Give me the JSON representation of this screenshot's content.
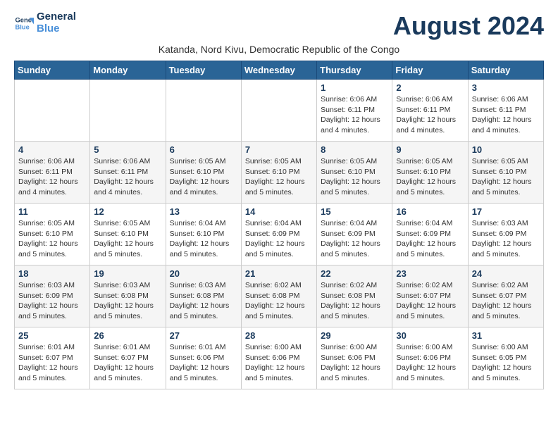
{
  "logo": {
    "line1": "General",
    "line2": "Blue"
  },
  "month_title": "August 2024",
  "subtitle": "Katanda, Nord Kivu, Democratic Republic of the Congo",
  "days_of_week": [
    "Sunday",
    "Monday",
    "Tuesday",
    "Wednesday",
    "Thursday",
    "Friday",
    "Saturday"
  ],
  "weeks": [
    [
      {
        "day": "",
        "info": ""
      },
      {
        "day": "",
        "info": ""
      },
      {
        "day": "",
        "info": ""
      },
      {
        "day": "",
        "info": ""
      },
      {
        "day": "1",
        "info": "Sunrise: 6:06 AM\nSunset: 6:11 PM\nDaylight: 12 hours and 4 minutes."
      },
      {
        "day": "2",
        "info": "Sunrise: 6:06 AM\nSunset: 6:11 PM\nDaylight: 12 hours and 4 minutes."
      },
      {
        "day": "3",
        "info": "Sunrise: 6:06 AM\nSunset: 6:11 PM\nDaylight: 12 hours and 4 minutes."
      }
    ],
    [
      {
        "day": "4",
        "info": "Sunrise: 6:06 AM\nSunset: 6:11 PM\nDaylight: 12 hours and 4 minutes."
      },
      {
        "day": "5",
        "info": "Sunrise: 6:06 AM\nSunset: 6:11 PM\nDaylight: 12 hours and 4 minutes."
      },
      {
        "day": "6",
        "info": "Sunrise: 6:05 AM\nSunset: 6:10 PM\nDaylight: 12 hours and 4 minutes."
      },
      {
        "day": "7",
        "info": "Sunrise: 6:05 AM\nSunset: 6:10 PM\nDaylight: 12 hours and 5 minutes."
      },
      {
        "day": "8",
        "info": "Sunrise: 6:05 AM\nSunset: 6:10 PM\nDaylight: 12 hours and 5 minutes."
      },
      {
        "day": "9",
        "info": "Sunrise: 6:05 AM\nSunset: 6:10 PM\nDaylight: 12 hours and 5 minutes."
      },
      {
        "day": "10",
        "info": "Sunrise: 6:05 AM\nSunset: 6:10 PM\nDaylight: 12 hours and 5 minutes."
      }
    ],
    [
      {
        "day": "11",
        "info": "Sunrise: 6:05 AM\nSunset: 6:10 PM\nDaylight: 12 hours and 5 minutes."
      },
      {
        "day": "12",
        "info": "Sunrise: 6:05 AM\nSunset: 6:10 PM\nDaylight: 12 hours and 5 minutes."
      },
      {
        "day": "13",
        "info": "Sunrise: 6:04 AM\nSunset: 6:10 PM\nDaylight: 12 hours and 5 minutes."
      },
      {
        "day": "14",
        "info": "Sunrise: 6:04 AM\nSunset: 6:09 PM\nDaylight: 12 hours and 5 minutes."
      },
      {
        "day": "15",
        "info": "Sunrise: 6:04 AM\nSunset: 6:09 PM\nDaylight: 12 hours and 5 minutes."
      },
      {
        "day": "16",
        "info": "Sunrise: 6:04 AM\nSunset: 6:09 PM\nDaylight: 12 hours and 5 minutes."
      },
      {
        "day": "17",
        "info": "Sunrise: 6:03 AM\nSunset: 6:09 PM\nDaylight: 12 hours and 5 minutes."
      }
    ],
    [
      {
        "day": "18",
        "info": "Sunrise: 6:03 AM\nSunset: 6:09 PM\nDaylight: 12 hours and 5 minutes."
      },
      {
        "day": "19",
        "info": "Sunrise: 6:03 AM\nSunset: 6:08 PM\nDaylight: 12 hours and 5 minutes."
      },
      {
        "day": "20",
        "info": "Sunrise: 6:03 AM\nSunset: 6:08 PM\nDaylight: 12 hours and 5 minutes."
      },
      {
        "day": "21",
        "info": "Sunrise: 6:02 AM\nSunset: 6:08 PM\nDaylight: 12 hours and 5 minutes."
      },
      {
        "day": "22",
        "info": "Sunrise: 6:02 AM\nSunset: 6:08 PM\nDaylight: 12 hours and 5 minutes."
      },
      {
        "day": "23",
        "info": "Sunrise: 6:02 AM\nSunset: 6:07 PM\nDaylight: 12 hours and 5 minutes."
      },
      {
        "day": "24",
        "info": "Sunrise: 6:02 AM\nSunset: 6:07 PM\nDaylight: 12 hours and 5 minutes."
      }
    ],
    [
      {
        "day": "25",
        "info": "Sunrise: 6:01 AM\nSunset: 6:07 PM\nDaylight: 12 hours and 5 minutes."
      },
      {
        "day": "26",
        "info": "Sunrise: 6:01 AM\nSunset: 6:07 PM\nDaylight: 12 hours and 5 minutes."
      },
      {
        "day": "27",
        "info": "Sunrise: 6:01 AM\nSunset: 6:06 PM\nDaylight: 12 hours and 5 minutes."
      },
      {
        "day": "28",
        "info": "Sunrise: 6:00 AM\nSunset: 6:06 PM\nDaylight: 12 hours and 5 minutes."
      },
      {
        "day": "29",
        "info": "Sunrise: 6:00 AM\nSunset: 6:06 PM\nDaylight: 12 hours and 5 minutes."
      },
      {
        "day": "30",
        "info": "Sunrise: 6:00 AM\nSunset: 6:06 PM\nDaylight: 12 hours and 5 minutes."
      },
      {
        "day": "31",
        "info": "Sunrise: 6:00 AM\nSunset: 6:05 PM\nDaylight: 12 hours and 5 minutes."
      }
    ]
  ]
}
